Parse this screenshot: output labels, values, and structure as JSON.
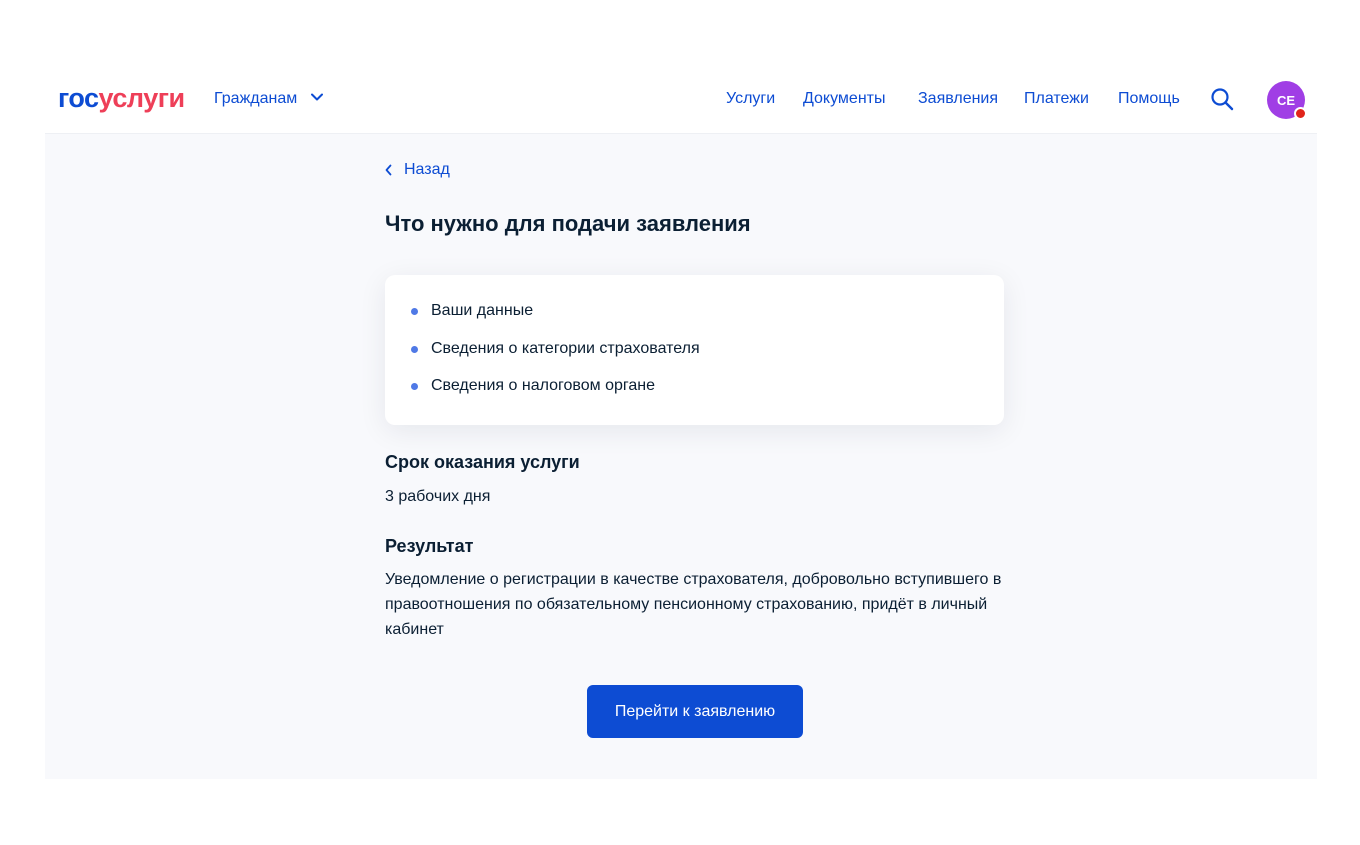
{
  "header": {
    "logo_part1": "гос",
    "logo_part2": "услуги",
    "audience_label": "Гражданам",
    "nav": [
      "Услуги",
      "Документы",
      "Заявления",
      "Платежи",
      "Помощь"
    ],
    "avatar_initials": "СЕ"
  },
  "page": {
    "back_label": "Назад",
    "title": "Что нужно для подачи заявления",
    "requirements": [
      "Ваши данные",
      "Сведения о категории страхователя",
      "Сведения о налоговом органе"
    ],
    "term_heading": "Срок оказания услуги",
    "term_value": "3 рабочих дня",
    "result_heading": "Результат",
    "result_text": "Уведомление о регистрации в качестве страхователя, добровольно вступившего в правоотношения по обязательному пенсионному страхованию, придёт в личный кабинет",
    "cta_label": "Перейти к заявлению"
  },
  "colors": {
    "brand_blue": "#0d4cd3",
    "brand_red": "#ee3f58",
    "avatar": "#a03ee5",
    "notification": "#e1251b",
    "page_background": "#f8f9fc"
  },
  "icons": [
    "chevron-down-icon",
    "search-icon",
    "chevron-left-icon"
  ]
}
